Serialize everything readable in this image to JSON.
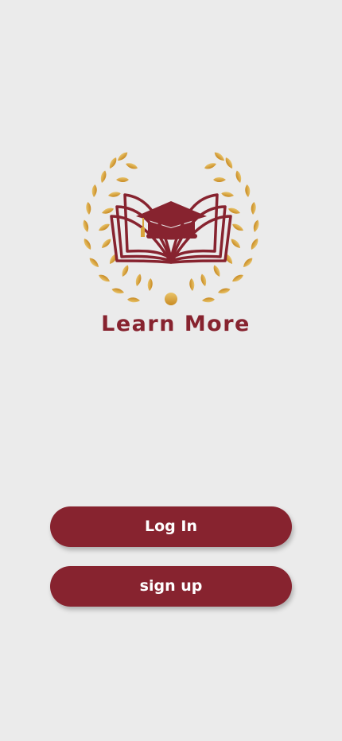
{
  "logo": {
    "text": "Learn More",
    "icon": "graduation-cap-book-laurel-logo",
    "primary_color": "#87232f",
    "gold_color": "#d9a43c"
  },
  "actions": {
    "login_label": "Log In",
    "signup_label": "sign up"
  },
  "colors": {
    "background": "#ebebeb",
    "button": "#87232f",
    "button_text": "#ffffff"
  }
}
